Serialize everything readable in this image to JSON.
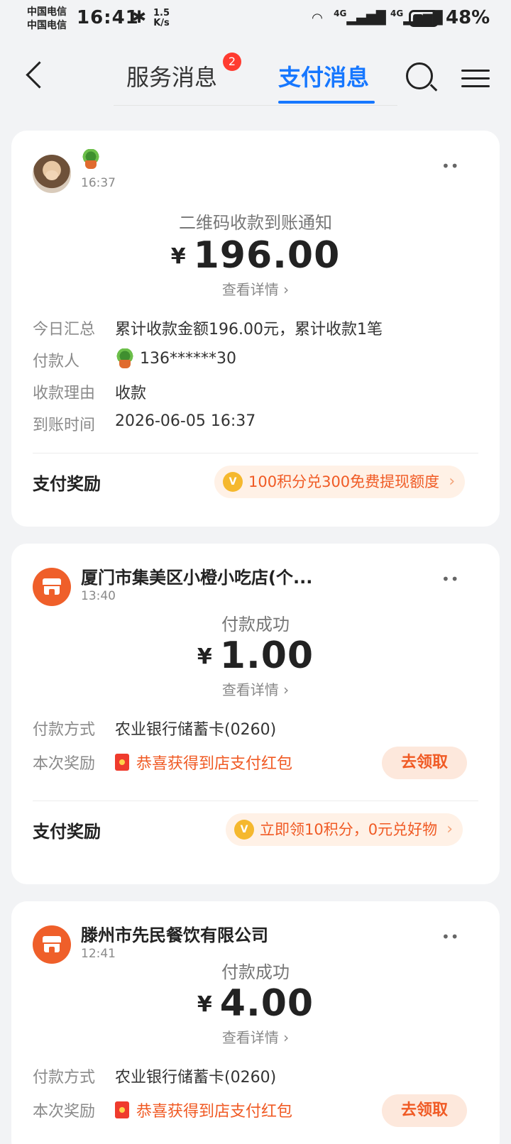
{
  "status_bar": {
    "carrier_1": "中国电信",
    "carrier_2": "中国电信",
    "time": "16:41",
    "speed_top": "1.5",
    "speed_bottom": "K/s",
    "signal_1": "4G",
    "signal_2": "4G",
    "battery": "48%"
  },
  "nav": {
    "tab_service": "服务消息",
    "tab_service_badge": "2",
    "tab_pay": "支付消息"
  },
  "cards": [
    {
      "time": "16:37",
      "title": "二维码收款到账通知",
      "currency": "¥",
      "amount": "196.00",
      "detail_link": "查看详情",
      "rows": [
        {
          "key": "今日汇总",
          "value": "累计收款金额196.00元，累计收款1笔"
        },
        {
          "key": "付款人",
          "value": "136******30"
        },
        {
          "key": "收款理由",
          "value": "收款"
        },
        {
          "key": "到账时间",
          "value": "2026-06-05 16:37"
        }
      ],
      "reward_label": "支付奖励",
      "reward_text": "100积分兑300免费提现额度"
    },
    {
      "merchant": "厦门市集美区小橙小吃店(个...",
      "time": "13:40",
      "title": "付款成功",
      "currency": "¥",
      "amount": "1.00",
      "detail_link": "查看详情",
      "rows": [
        {
          "key": "付款方式",
          "value": "农业银行储蓄卡(0260)"
        },
        {
          "key": "本次奖励",
          "value": "恭喜获得到店支付红包"
        }
      ],
      "claim_button": "去领取",
      "reward_label": "支付奖励",
      "reward_text": "立即领10积分，0元兑好物"
    },
    {
      "merchant": "滕州市先民餐饮有限公司",
      "time": "12:41",
      "title": "付款成功",
      "currency": "¥",
      "amount": "4.00",
      "detail_link": "查看详情",
      "rows": [
        {
          "key": "付款方式",
          "value": "农业银行储蓄卡(0260)"
        },
        {
          "key": "本次奖励",
          "value": "恭喜获得到店支付红包"
        }
      ],
      "claim_button": "去领取"
    }
  ],
  "icons": {
    "back": "chevron-left-icon",
    "search": "search-icon",
    "menu": "menu-icon",
    "more": "more-icon",
    "coin": "coin-icon",
    "redpack": "red-envelope-icon"
  },
  "colors": {
    "accent": "#1677ff",
    "orange": "#f05a24",
    "badge": "#ff3b30",
    "background": "#f2f3f5"
  }
}
